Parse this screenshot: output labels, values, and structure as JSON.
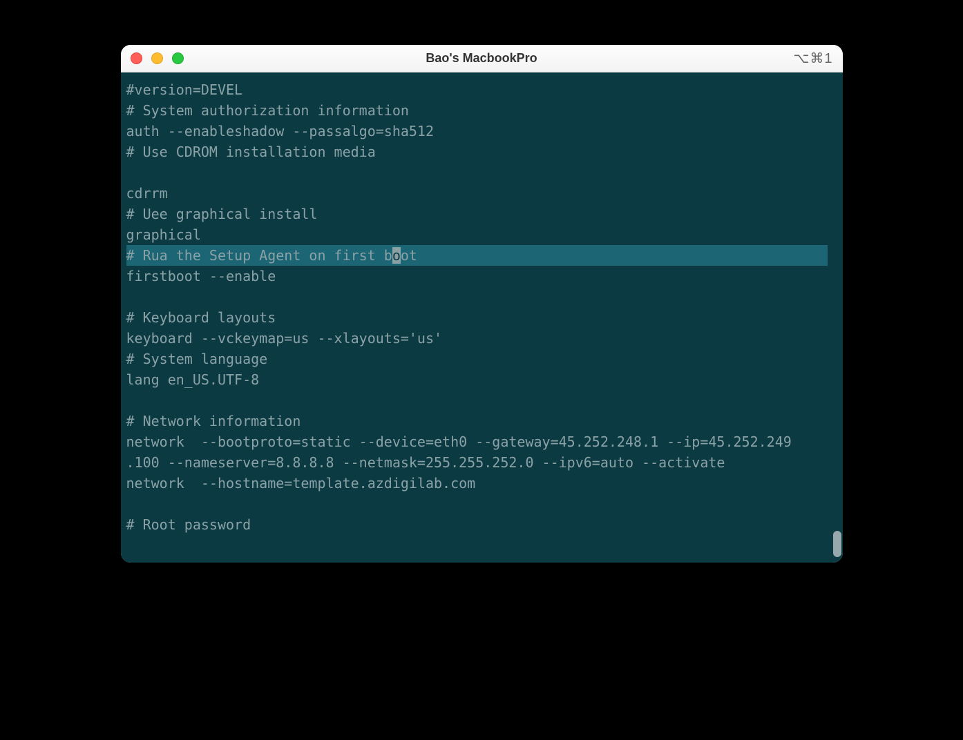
{
  "window": {
    "title": "Bao's MacbookPro",
    "shortcut": "⌥⌘1"
  },
  "terminal": {
    "lines": [
      "#version=DEVEL",
      "# System authorization information",
      "auth --enableshadow --passalgo=sha512",
      "# Use CDROM installation media",
      "",
      "cdrrm",
      "# Uee graphical install",
      "graphical",
      "# Rua the Setup Agent on first boot",
      "firstboot --enable",
      "",
      "# Keyboard layouts",
      "keyboard --vckeymap=us --xlayouts='us'",
      "# System language",
      "lang en_US.UTF-8",
      "",
      "# Network information",
      "network  --bootproto=static --device=eth0 --gateway=45.252.248.1 --ip=45.252.249.100 --nameserver=8.8.8.8 --netmask=255.255.252.0 --ipv6=auto --activate",
      "network  --hostname=template.azdigilab.com",
      "",
      "# Root password"
    ],
    "highlighted_index": 8,
    "cursor": {
      "line_index": 8,
      "before": "# Rua the Setup Agent on first b",
      "char": "o",
      "after": "ot"
    }
  }
}
